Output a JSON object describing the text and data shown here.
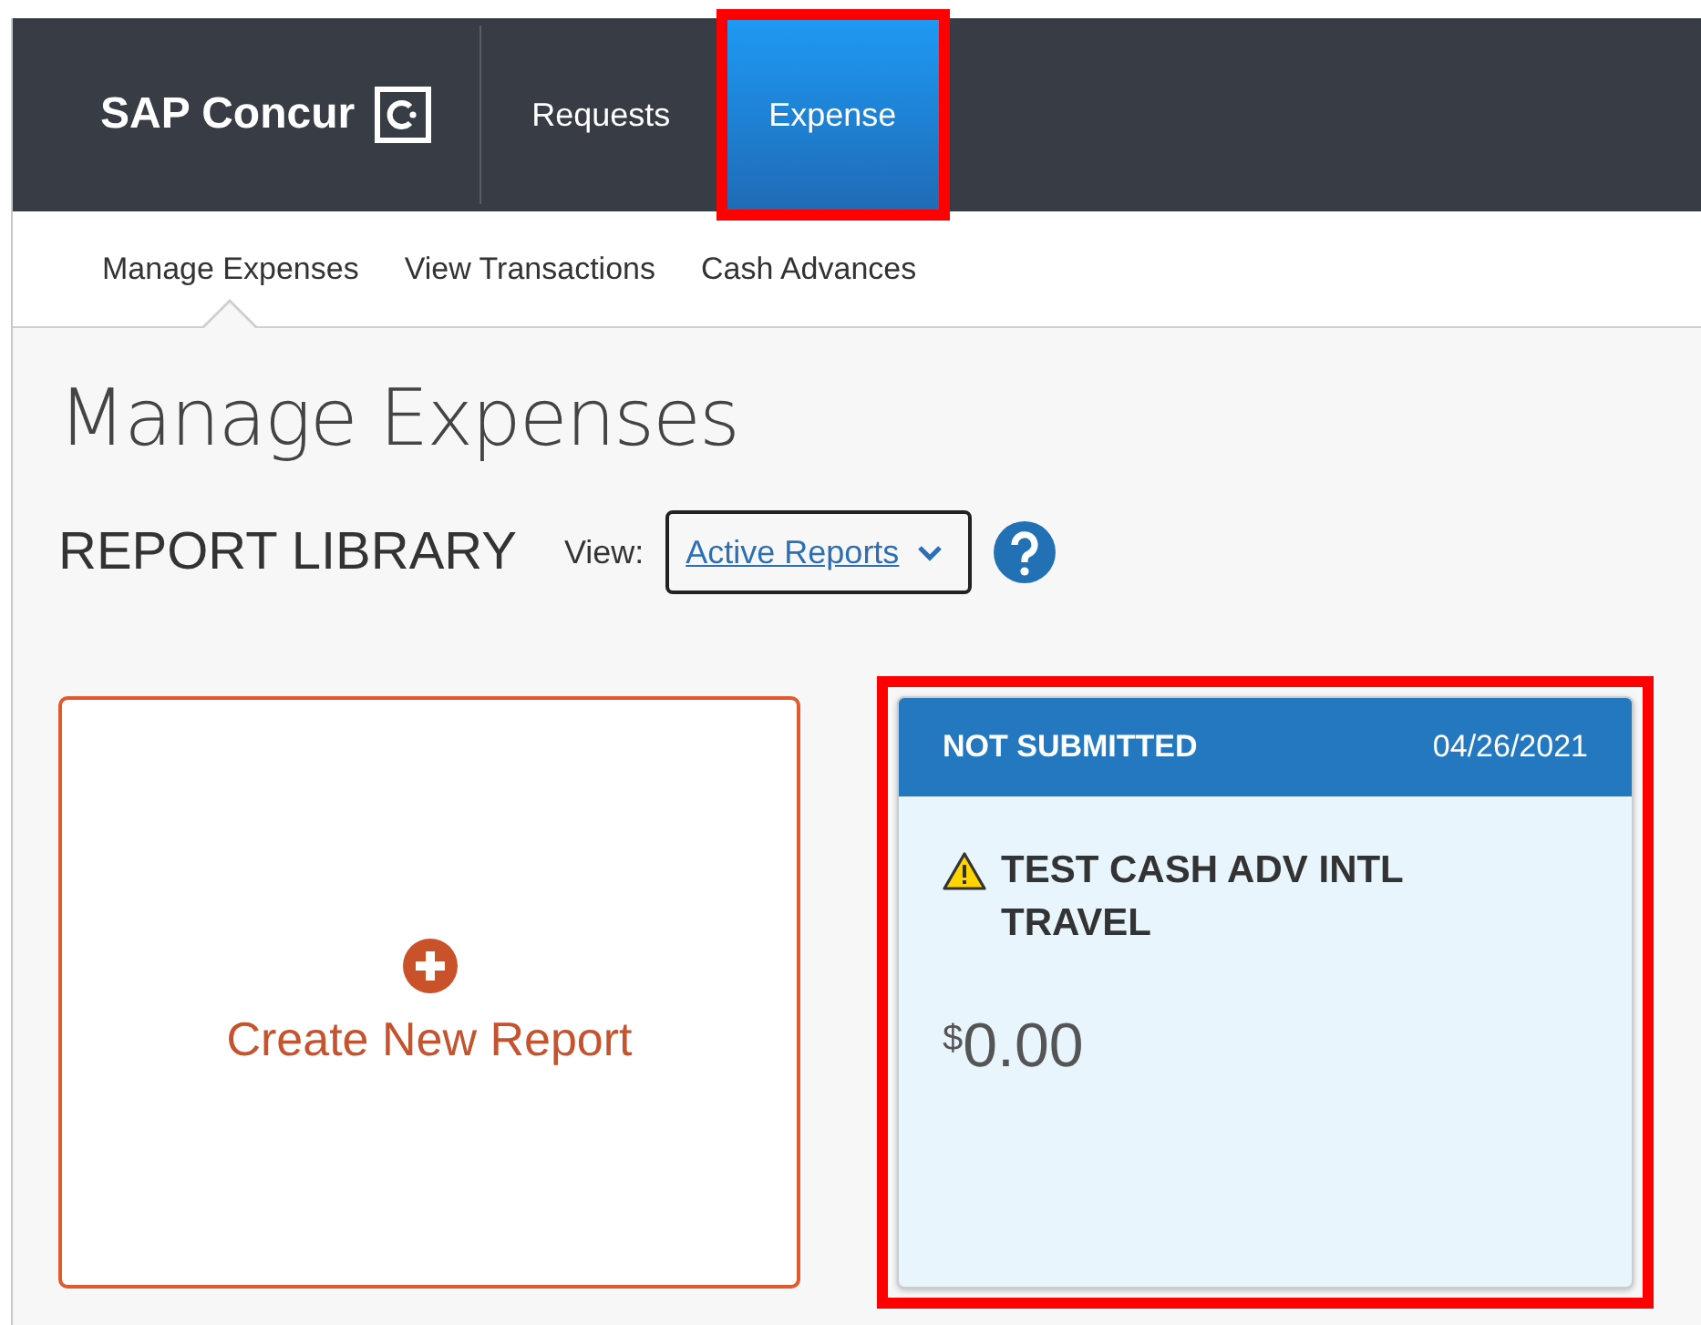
{
  "brand": {
    "name": "SAP Concur"
  },
  "top_tabs": [
    {
      "label": "Requests",
      "selected": false,
      "highlighted": false
    },
    {
      "label": "Expense",
      "selected": true,
      "highlighted": true
    }
  ],
  "sub_tabs": [
    {
      "label": "Manage Expenses",
      "selected": true
    },
    {
      "label": "View Transactions",
      "selected": false
    },
    {
      "label": "Cash Advances",
      "selected": false
    }
  ],
  "page_title": "Manage Expenses",
  "library": {
    "heading": "REPORT LIBRARY",
    "view_label": "View:",
    "view_value": "Active Reports"
  },
  "create_card": {
    "label": "Create New Report"
  },
  "reports": [
    {
      "status": "NOT SUBMITTED",
      "date": "04/26/2021",
      "name": "TEST CASH ADV INTL TRAVEL",
      "warning": true,
      "currency": "$",
      "amount": "0.00",
      "highlighted": true
    }
  ]
}
